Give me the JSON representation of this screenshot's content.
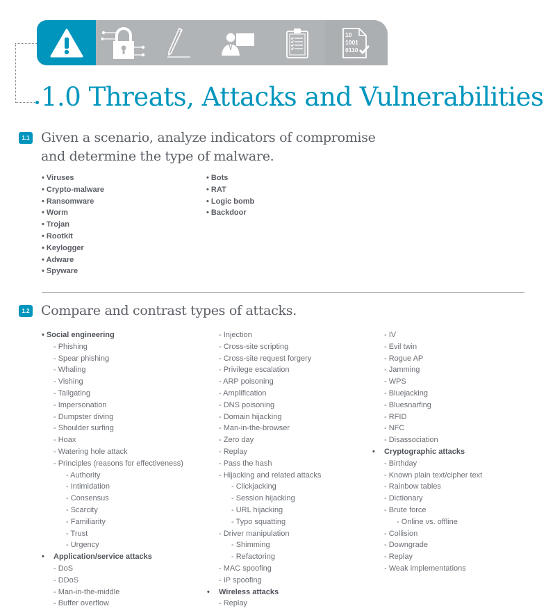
{
  "tabs": [
    {
      "icon": "warning-icon",
      "active": true
    },
    {
      "icon": "padlock-network-icon",
      "active": false
    },
    {
      "icon": "pen-icon",
      "active": false
    },
    {
      "icon": "presenter-icon",
      "active": false
    },
    {
      "icon": "clipboard-checklist-icon",
      "active": false
    },
    {
      "icon": "binary-document-check-icon",
      "active": false
    }
  ],
  "binary_icon_text": [
    "10",
    "1001",
    "0110"
  ],
  "colors": {
    "accent": "#0095bd",
    "tabbar": "#b1b4b7",
    "text": "#5a5f66"
  },
  "main_title": "1.0 Threats, Attacks and Vulnerabilities",
  "section_1_1": {
    "badge": "1.1",
    "title_line1": "Given a scenario, analyze indicators of compromise",
    "title_line2": "and determine the type of malware.",
    "col1": [
      "• Viruses",
      "• Crypto-malware",
      "• Ransomware",
      "• Worm",
      "• Trojan",
      "• Rootkit",
      "• Keylogger",
      "• Adware",
      "• Spyware"
    ],
    "col2": [
      "• Bots",
      "• RAT",
      "• Logic bomb",
      "• Backdoor"
    ]
  },
  "section_1_2": {
    "badge": "1.2",
    "title": "Compare and contrast types of attacks.",
    "col1": [
      {
        "text": "• Social engineering",
        "level": "head"
      },
      {
        "text": "- Phishing",
        "level": "l1"
      },
      {
        "text": "- Spear phishing",
        "level": "l1"
      },
      {
        "text": "- Whaling",
        "level": "l1"
      },
      {
        "text": "- Vishing",
        "level": "l1"
      },
      {
        "text": "- Tailgating",
        "level": "l1"
      },
      {
        "text": "- Impersonation",
        "level": "l1"
      },
      {
        "text": "- Dumpster diving",
        "level": "l1"
      },
      {
        "text": "- Shoulder surfing",
        "level": "l1"
      },
      {
        "text": "- Hoax",
        "level": "l1"
      },
      {
        "text": "- Watering hole attack",
        "level": "l1"
      },
      {
        "text": "- Principles (reasons for effectiveness)",
        "level": "l1"
      },
      {
        "text": "- Authority",
        "level": "l2"
      },
      {
        "text": "- Intimidation",
        "level": "l2"
      },
      {
        "text": "- Consensus",
        "level": "l2"
      },
      {
        "text": "- Scarcity",
        "level": "l2"
      },
      {
        "text": "- Familiarity",
        "level": "l2"
      },
      {
        "text": "- Trust",
        "level": "l2"
      },
      {
        "text": "- Urgency",
        "level": "l2"
      },
      {
        "text": "Application/service attacks",
        "level": "h2"
      },
      {
        "text": "- DoS",
        "level": "l1"
      },
      {
        "text": "- DDoS",
        "level": "l1"
      },
      {
        "text": "- Man-in-the-middle",
        "level": "l1"
      },
      {
        "text": "- Buffer overflow",
        "level": "l1"
      }
    ],
    "col2": [
      {
        "text": "- Injection",
        "level": "l1"
      },
      {
        "text": "- Cross-site scripting",
        "level": "l1"
      },
      {
        "text": "- Cross-site request forgery",
        "level": "l1"
      },
      {
        "text": "- Privilege escalation",
        "level": "l1"
      },
      {
        "text": "- ARP poisoning",
        "level": "l1"
      },
      {
        "text": "- Amplification",
        "level": "l1"
      },
      {
        "text": "- DNS poisoning",
        "level": "l1"
      },
      {
        "text": "- Domain hijacking",
        "level": "l1"
      },
      {
        "text": "- Man-in-the-browser",
        "level": "l1"
      },
      {
        "text": "- Zero day",
        "level": "l1"
      },
      {
        "text": "- Replay",
        "level": "l1"
      },
      {
        "text": "- Pass the hash",
        "level": "l1"
      },
      {
        "text": "- Hijacking and related attacks",
        "level": "l1"
      },
      {
        "text": "- Clickjacking",
        "level": "l2"
      },
      {
        "text": "- Session hijacking",
        "level": "l2"
      },
      {
        "text": "- URL hijacking",
        "level": "l2"
      },
      {
        "text": "- Typo squatting",
        "level": "l2"
      },
      {
        "text": "- Driver manipulation",
        "level": "l1"
      },
      {
        "text": "- Shimming",
        "level": "l2"
      },
      {
        "text": "- Refactoring",
        "level": "l2"
      },
      {
        "text": "- MAC spoofing",
        "level": "l1"
      },
      {
        "text": "- IP spoofing",
        "level": "l1"
      },
      {
        "text": "Wireless attacks",
        "level": "h2"
      },
      {
        "text": "- Replay",
        "level": "l1"
      }
    ],
    "col3": [
      {
        "text": "- IV",
        "level": "l1"
      },
      {
        "text": "- Evil twin",
        "level": "l1"
      },
      {
        "text": "- Rogue AP",
        "level": "l1"
      },
      {
        "text": "- Jamming",
        "level": "l1"
      },
      {
        "text": "- WPS",
        "level": "l1"
      },
      {
        "text": "- Bluejacking",
        "level": "l1"
      },
      {
        "text": "- Bluesnarfing",
        "level": "l1"
      },
      {
        "text": "- RFID",
        "level": "l1"
      },
      {
        "text": "- NFC",
        "level": "l1"
      },
      {
        "text": "- Disassociation",
        "level": "l1"
      },
      {
        "text": "Cryptographic attacks",
        "level": "h2"
      },
      {
        "text": "- Birthday",
        "level": "l1"
      },
      {
        "text": "- Known plain text/cipher text",
        "level": "l1"
      },
      {
        "text": "- Rainbow tables",
        "level": "l1"
      },
      {
        "text": "- Dictionary",
        "level": "l1"
      },
      {
        "text": "- Brute force",
        "level": "l1"
      },
      {
        "text": "- Online vs. offline",
        "level": "l2"
      },
      {
        "text": "- Collision",
        "level": "l1"
      },
      {
        "text": "- Downgrade",
        "level": "l1"
      },
      {
        "text": "- Replay",
        "level": "l1"
      },
      {
        "text": "- Weak implementations",
        "level": "l1"
      }
    ]
  }
}
